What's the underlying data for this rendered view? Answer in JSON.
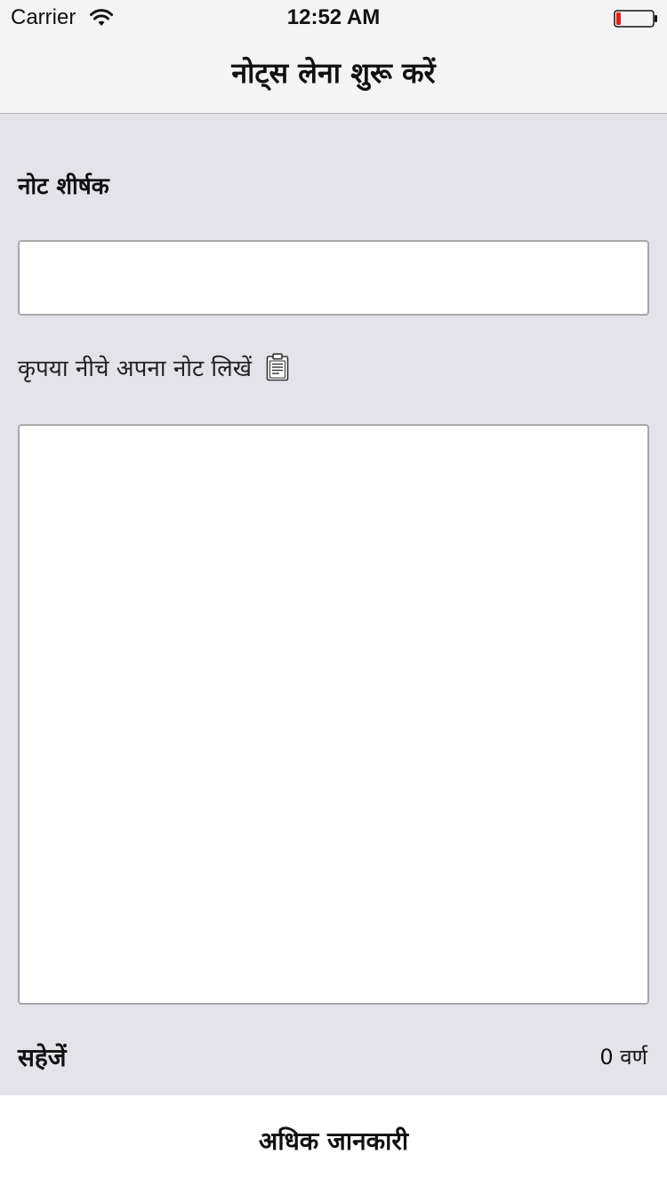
{
  "status_bar": {
    "carrier": "Carrier",
    "time": "12:52 AM",
    "wifi_icon": "wifi-icon",
    "battery_icon": "battery-low-icon",
    "battery_level_color": "#e0201b"
  },
  "nav": {
    "title": "नोट्स लेना शुरू करें"
  },
  "form": {
    "title_label": "नोट शीर्षक",
    "title_value": "",
    "instruction_label": "कृपया नीचे अपना नोट लिखें",
    "instruction_icon": "clipboard-icon",
    "body_value": "",
    "save_label": "सहेजें",
    "char_count": "0 वर्ण"
  },
  "bottom_bar": {
    "more_info_label": "अधिक जानकारी"
  },
  "colors": {
    "background": "#e4e3ea",
    "nav_background": "#f4f4f5",
    "input_border": "#a9a9ac"
  }
}
